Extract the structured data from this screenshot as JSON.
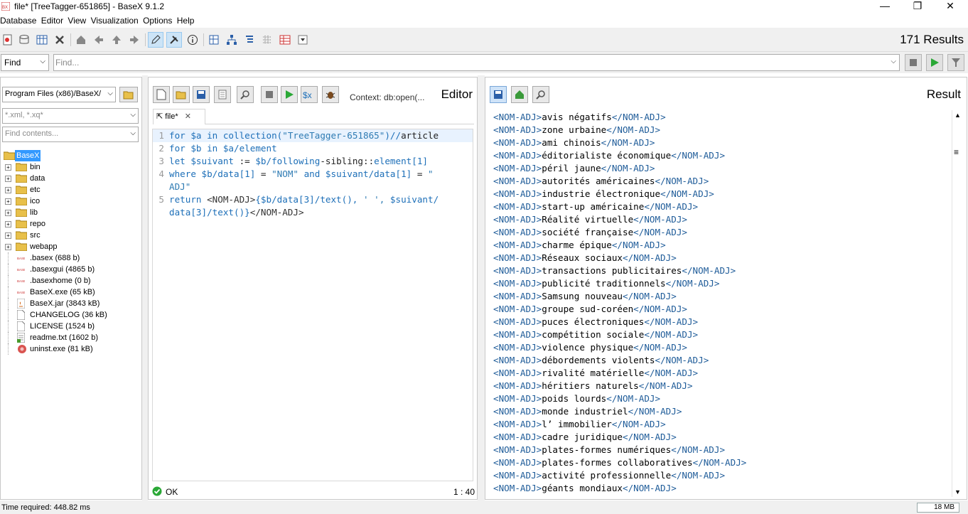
{
  "window": {
    "title": "file* [TreeTagger-651865] - BaseX 9.1.2",
    "minimize": "—",
    "maximize": "❐",
    "close": "✕"
  },
  "menu": [
    "Database",
    "Editor",
    "View",
    "Visualization",
    "Options",
    "Help"
  ],
  "results_count": "171 Results",
  "find": {
    "mode": "Find",
    "placeholder": "Find..."
  },
  "left": {
    "path": "Program Files (x86)/BaseX/",
    "filter_placeholder": "*.xml, *.xq*",
    "contents_placeholder": "Find contents...",
    "tree": [
      {
        "label": "BaseX",
        "type": "root"
      },
      {
        "label": "bin",
        "type": "folder"
      },
      {
        "label": "data",
        "type": "folder"
      },
      {
        "label": "etc",
        "type": "folder"
      },
      {
        "label": "ico",
        "type": "folder"
      },
      {
        "label": "lib",
        "type": "folder"
      },
      {
        "label": "repo",
        "type": "folder"
      },
      {
        "label": "src",
        "type": "folder"
      },
      {
        "label": "webapp",
        "type": "folder"
      },
      {
        "label": ".basex (688 b)",
        "type": "basex"
      },
      {
        "label": ".basexgui (4865 b)",
        "type": "basex"
      },
      {
        "label": ".basexhome (0 b)",
        "type": "basex"
      },
      {
        "label": "BaseX.exe (65 kB)",
        "type": "basex"
      },
      {
        "label": "BaseX.jar (3843 kB)",
        "type": "jar"
      },
      {
        "label": "CHANGELOG (36 kB)",
        "type": "file"
      },
      {
        "label": "LICENSE (1524 b)",
        "type": "file"
      },
      {
        "label": "readme.txt (1602 b)",
        "type": "text"
      },
      {
        "label": "uninst.exe (81 kB)",
        "type": "exe"
      }
    ]
  },
  "editor": {
    "context": "Context: db:open(...",
    "label": "Editor",
    "tab": "file*",
    "lines": [
      {
        "n": "1",
        "segs": [
          {
            "c": "kw",
            "t": "for "
          },
          {
            "c": "var",
            "t": "$a "
          },
          {
            "c": "kw",
            "t": "in "
          },
          {
            "c": "var",
            "t": "collection("
          },
          {
            "c": "str",
            "t": "\"TreeTagger-651865\""
          },
          {
            "c": "var",
            "t": ")//"
          },
          {
            "c": "plain",
            "t": "article"
          }
        ]
      },
      {
        "n": "2",
        "segs": [
          {
            "c": "kw",
            "t": "for "
          },
          {
            "c": "var",
            "t": "$b "
          },
          {
            "c": "kw",
            "t": "in "
          },
          {
            "c": "var",
            "t": "$a/element"
          }
        ]
      },
      {
        "n": "3",
        "segs": [
          {
            "c": "kw",
            "t": "let "
          },
          {
            "c": "var",
            "t": "$suivant "
          },
          {
            "c": "plain",
            "t": ":= "
          },
          {
            "c": "var",
            "t": "$b/following"
          },
          {
            "c": "plain",
            "t": "-sibling::"
          },
          {
            "c": "var",
            "t": "element[1]"
          }
        ]
      },
      {
        "n": "4",
        "segs": [
          {
            "c": "kw",
            "t": "where "
          },
          {
            "c": "var",
            "t": "$b/data[1] "
          },
          {
            "c": "plain",
            "t": "= "
          },
          {
            "c": "str",
            "t": "\"NOM\" "
          },
          {
            "c": "kw",
            "t": "and "
          },
          {
            "c": "var",
            "t": "$suivant/data[1] "
          },
          {
            "c": "plain",
            "t": "= "
          },
          {
            "c": "str",
            "t": "\""
          }
        ]
      },
      {
        "n": "",
        "segs": [
          {
            "c": "str",
            "t": "ADJ\""
          }
        ]
      },
      {
        "n": "5",
        "segs": [
          {
            "c": "kw",
            "t": "return "
          },
          {
            "c": "tag",
            "t": "<NOM-ADJ>"
          },
          {
            "c": "var",
            "t": "{$b/data[3]/text(), "
          },
          {
            "c": "str",
            "t": "' ', "
          },
          {
            "c": "var",
            "t": "$suivant/"
          }
        ]
      },
      {
        "n": "",
        "segs": [
          {
            "c": "var",
            "t": "data[3]/text()}"
          },
          {
            "c": "tag",
            "t": "</NOM-ADJ>"
          }
        ]
      }
    ],
    "status": "OK",
    "position": "1 : 40"
  },
  "result": {
    "label": "Result",
    "open_tag": "<NOM-ADJ>",
    "close_tag": "</NOM-ADJ>",
    "items": [
      "avis négatifs",
      "zone urbaine",
      "ami chinois",
      "éditorialiste économique",
      "péril jaune",
      "autorités américaines",
      "industrie électronique",
      "start-up américaine",
      "Réalité virtuelle",
      "société française",
      "charme épique",
      "Réseaux sociaux",
      "transactions publicitaires",
      "publicité traditionnels",
      "Samsung nouveau",
      "groupe sud-coréen",
      "puces électroniques",
      "compétition sociale",
      "violence physique",
      "débordements violents",
      "rivalité matérielle",
      "héritiers naturels",
      "poids lourds",
      "monde industriel",
      "l’ immobilier",
      "cadre juridique",
      "plates-formes numériques",
      "plates-formes collaboratives",
      "activité professionnelle",
      "géants mondiaux"
    ]
  },
  "status": {
    "time": "Time required: 448.82 ms",
    "memory": "18 MB"
  },
  "colors": {
    "accent": "#1d6fb8",
    "tag": "#1f5c99",
    "folder": "#e8c04a",
    "ok": "#2aa836"
  }
}
